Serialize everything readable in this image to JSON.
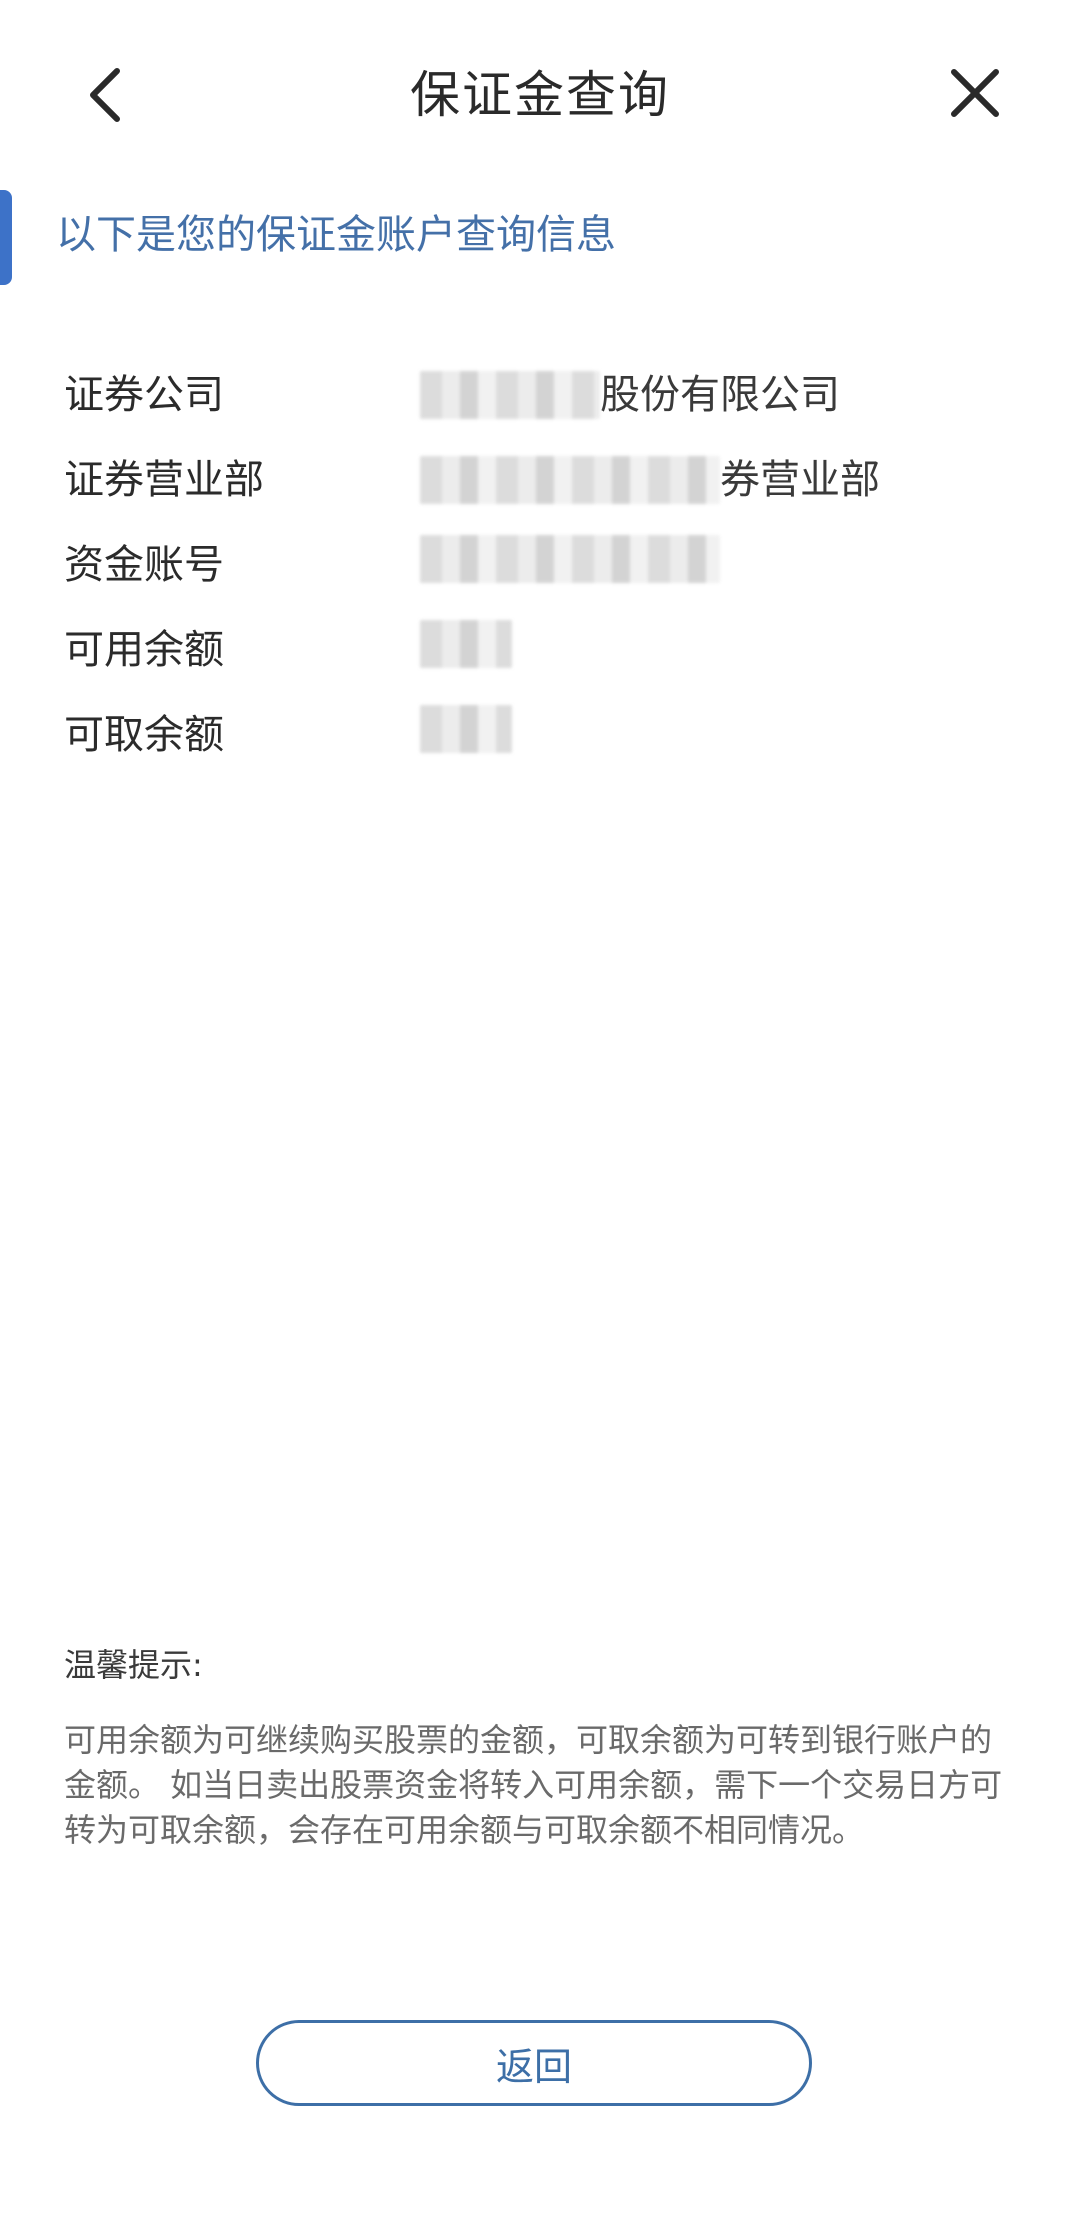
{
  "header": {
    "title": "保证金查询",
    "back_icon": "chevron-left-icon",
    "close_icon": "close-icon"
  },
  "section": {
    "heading": "以下是您的保证金账户查询信息"
  },
  "info": [
    {
      "label": "证券公司",
      "value_suffix": "股份有限公司"
    },
    {
      "label": "证券营业部",
      "value_suffix": "券营业部"
    },
    {
      "label": "资金账号",
      "value_suffix": ""
    },
    {
      "label": "可用余额",
      "value_suffix": ""
    },
    {
      "label": "可取余额",
      "value_suffix": ""
    }
  ],
  "tips": {
    "title": "温馨提示:",
    "body": "可用余额为可继续购买股票的金额，可取余额为可转到银行账户的金额。 如当日卖出股票资金将转入可用余额，需下一个交易日方可转为可取余额，会存在可用余额与可取余额不相同情况。"
  },
  "footer": {
    "return_label": "返回"
  },
  "colors": {
    "accent": "#3d72c8",
    "heading_text": "#4470a8",
    "button_border": "#3d6fa7"
  }
}
